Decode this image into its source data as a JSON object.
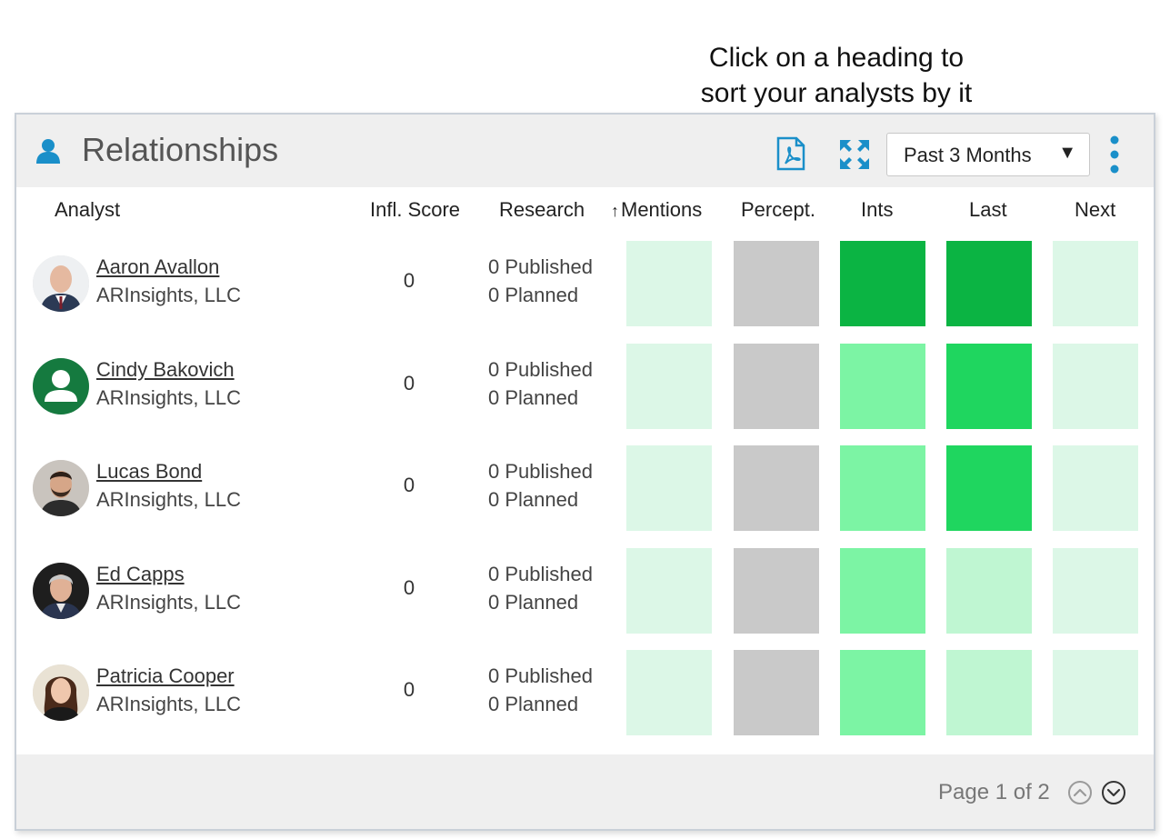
{
  "callout": {
    "line1": "Click on a heading to",
    "line2": "sort your analysts by it"
  },
  "panel": {
    "title": "Relationships",
    "period_select": {
      "value": "Past 3 Months",
      "caret": "▼"
    }
  },
  "columns": {
    "analyst": "Analyst",
    "infl_score": "Infl. Score",
    "research": "Research",
    "mentions_sort": "↑",
    "mentions": "Mentions",
    "percept": "Percept.",
    "ints": "Ints",
    "last": "Last",
    "next": "Next"
  },
  "colors": {
    "very_light_green": "#dcf7e7",
    "light_green": "#bff6d2",
    "mid_green": "#7cf4a4",
    "bright_green": "#1fd65f",
    "dark_green": "#0bb443",
    "gray": "#c9c9c9",
    "accent_blue": "#1a8fc9"
  },
  "rows": [
    {
      "name": "Aaron Avallon",
      "company": "ARInsights, LLC",
      "score": "0",
      "published": "0 Published",
      "planned": "0 Planned",
      "avatar": "photo-bald-man-suit",
      "cells": {
        "mentions": "very_light_green",
        "percept": "gray",
        "ints": "dark_green",
        "last": "dark_green",
        "next": "very_light_green"
      }
    },
    {
      "name": "Cindy Bakovich",
      "company": "ARInsights, LLC",
      "score": "0",
      "published": "0 Published",
      "planned": "0 Planned",
      "avatar": "placeholder-user-icon",
      "cells": {
        "mentions": "very_light_green",
        "percept": "gray",
        "ints": "mid_green",
        "last": "bright_green",
        "next": "very_light_green"
      }
    },
    {
      "name": "Lucas Bond",
      "company": "ARInsights, LLC",
      "score": "0",
      "published": "0 Published",
      "planned": "0 Planned",
      "avatar": "photo-bearded-man",
      "cells": {
        "mentions": "very_light_green",
        "percept": "gray",
        "ints": "mid_green",
        "last": "bright_green",
        "next": "very_light_green"
      }
    },
    {
      "name": "Ed Capps",
      "company": "ARInsights, LLC",
      "score": "0",
      "published": "0 Published",
      "planned": "0 Planned",
      "avatar": "photo-gray-haired-man",
      "cells": {
        "mentions": "very_light_green",
        "percept": "gray",
        "ints": "mid_green",
        "last": "light_green",
        "next": "very_light_green"
      }
    },
    {
      "name": "Patricia Cooper",
      "company": "ARInsights, LLC",
      "score": "0",
      "published": "0 Published",
      "planned": "0 Planned",
      "avatar": "photo-woman-dark-hair",
      "cells": {
        "mentions": "very_light_green",
        "percept": "gray",
        "ints": "mid_green",
        "last": "light_green",
        "next": "very_light_green"
      }
    }
  ],
  "footer": {
    "page_label": "Page 1 of 2"
  }
}
